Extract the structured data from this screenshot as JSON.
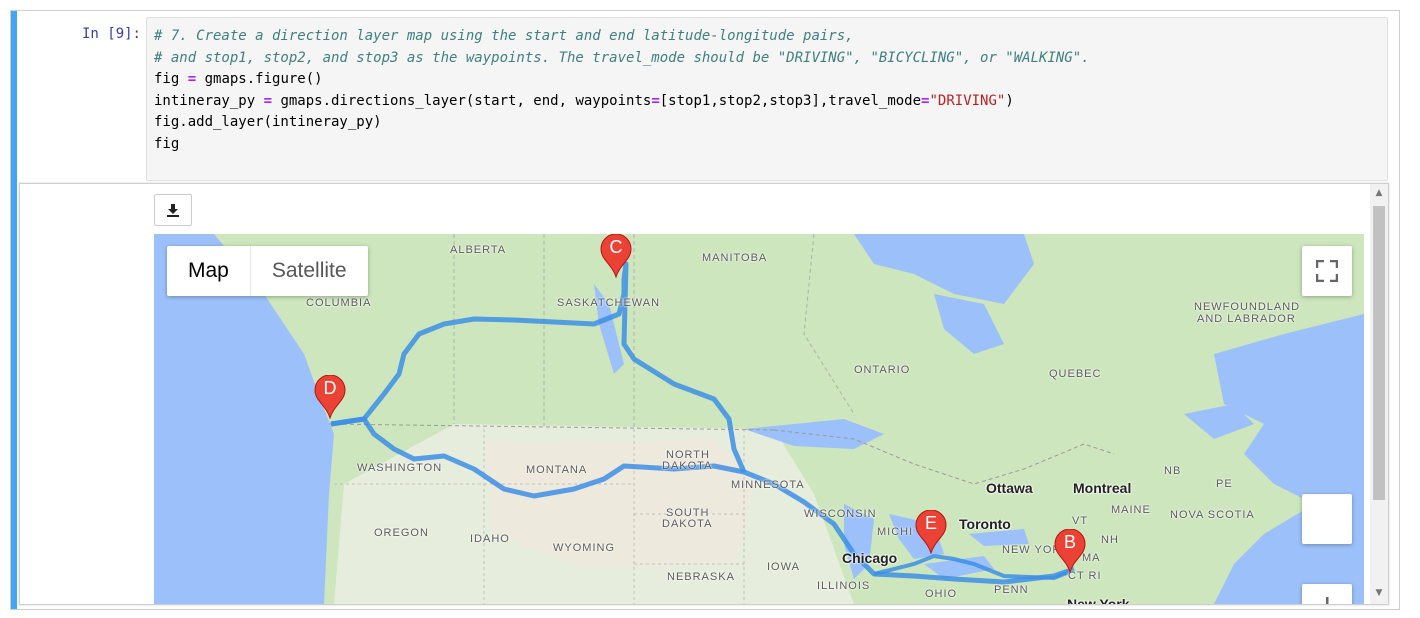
{
  "notebook": {
    "prompt": "In [9]:",
    "code_lines": {
      "l1": "# 7. Create a direction layer map using the start and end latitude-longitude pairs,",
      "l2": "# and stop1, stop2, and stop3 as the waypoints. The travel_mode should be \"DRIVING\", \"BICYCLING\", or \"WALKING\".",
      "l3a": "fig ",
      "l3op": "=",
      "l3b": " gmaps.figure()",
      "l4a": "intineray_py ",
      "l4op": "=",
      "l4b": " gmaps.directions_layer(start, end, waypoints",
      "l4op2": "=",
      "l4c": "[stop1,stop2,stop3],travel_mode",
      "l4op3": "=",
      "l4str": "\"DRIVING\"",
      "l4d": ")",
      "l5": "fig.add_layer(intineray_py)",
      "l6": "fig"
    }
  },
  "map": {
    "map_type_map": "Map",
    "map_type_satellite": "Satellite",
    "regions": {
      "alberta": "ALBERTA",
      "manitoba": "MANITOBA",
      "columbia": "COLUMBIA",
      "saskatchewan": "SASKATCHEWAN",
      "newfoundland1": "NEWFOUNDLAND",
      "newfoundland2": "AND LABRADOR",
      "ontario": "ONTARIO",
      "quebec": "QUEBEC",
      "washington": "WASHINGTON",
      "montana": "MONTANA",
      "north_dakota1": "NORTH",
      "north_dakota2": "DAKOTA",
      "minnesota": "MINNESOTA",
      "nb": "NB",
      "pe": "PE",
      "maine": "MAINE",
      "nova_scotia": "NOVA SCOTIA",
      "oregon": "OREGON",
      "idaho": "IDAHO",
      "south_dakota1": "SOUTH",
      "south_dakota2": "DAKOTA",
      "wisconsin": "WISCONSIN",
      "michigan": "MICHI",
      "wyoming": "WYOMING",
      "iowa": "IOWA",
      "nebraska": "NEBRASKA",
      "illinois": "ILLINOIS",
      "ohio": "OHIO",
      "penn": "PENN",
      "vt": "VT",
      "nh": "NH",
      "ma": "MA",
      "ct_ri": "CT RI",
      "new_york": "NEW YORK"
    },
    "cities": {
      "ottawa": "Ottawa",
      "montreal": "Montreal",
      "toronto": "Toronto",
      "chicago": "Chicago",
      "new_york_city": "New York"
    },
    "markers": {
      "b": "B",
      "c": "C",
      "d": "D",
      "e": "E"
    },
    "colors": {
      "route": "#3c8ee6",
      "marker": "#ea4335",
      "water": "#9cc0f9",
      "land": "#cde6bd",
      "cell_accent": "#42a5f5"
    },
    "icons": {
      "download": "download-icon",
      "fullscreen": "fullscreen-icon",
      "marker": "map-pin-icon"
    }
  }
}
